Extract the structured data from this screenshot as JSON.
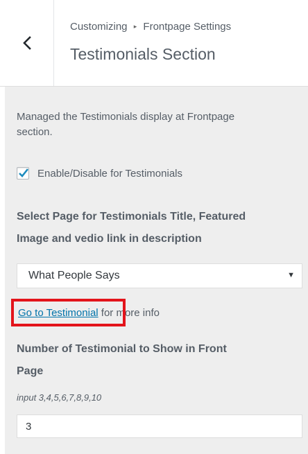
{
  "header": {
    "breadcrumb_parent": "Customizing",
    "breadcrumb_separator": "▸",
    "breadcrumb_section": "Frontpage Settings",
    "title": "Testimonials Section",
    "back_icon": "chevron-left-icon"
  },
  "section": {
    "description_line1": "Managed the Testimonials display at Frontpage",
    "description_line2": "section.",
    "enable_checkbox": {
      "label": "Enable/Disable for Testimonials",
      "checked": true,
      "check_color": "#0073aa"
    },
    "page_select": {
      "label_line1": "Select Page for Testimonials Title, Featured",
      "label_line2": "Image and vedio link in description",
      "selected": "What People Says",
      "caret": "▼"
    },
    "link_hint": {
      "link_text": "Go to Testimonial",
      "suffix_text": "for more info",
      "highlight_color": "#e3141b"
    },
    "number_field": {
      "label_line1": "Number of Testimonial to Show in Front",
      "label_line2": "Page",
      "hint": "input 3,4,5,6,7,8,9,10",
      "value": "3"
    }
  }
}
